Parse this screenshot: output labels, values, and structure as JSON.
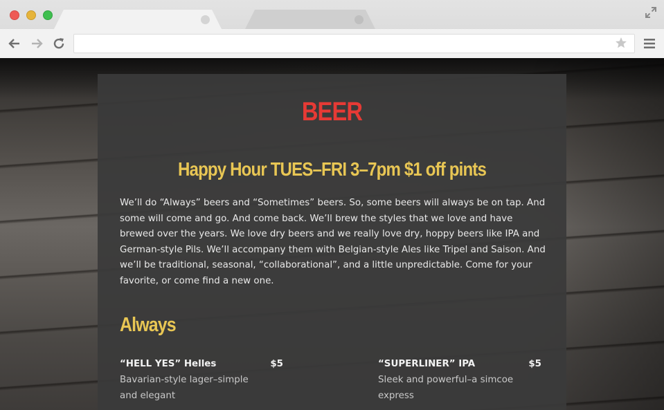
{
  "browser": {
    "tabs": [
      {
        "label": "",
        "active": true
      },
      {
        "label": "",
        "active": false
      }
    ],
    "address_bar": {
      "value": "",
      "placeholder": ""
    }
  },
  "page": {
    "title": "BEER",
    "happy_hour": "Happy Hour TUES–FRI 3–7pm $1 off pints",
    "intro": "We’ll do “Always” beers and “Sometimes” beers. So, some beers will always be on tap. And some will come and go. And come back. We’ll brew the styles that we love and have brewed over the years. We love dry beers and we really love dry, hoppy beers like IPA and German-style Pils. We’ll accompany them with Belgian-style Ales like Tripel and Saison. And we’ll be traditional, seasonal, “collaborational”, and a little unpredictable. Come for your favorite, or come find a new one.",
    "always_heading": "Always",
    "beers": [
      {
        "name": "“HELL YES” Helles",
        "price": "$5",
        "description": "Bavarian-style lager–simple and elegant"
      },
      {
        "name": "“SUPERLINER” IPA",
        "price": "$5",
        "description": "Sleek and powerful–a simcoe express"
      }
    ]
  },
  "colors": {
    "title_red": "#e63a35",
    "heading_yellow": "#e8c654",
    "panel_bg": "#3a3a3a",
    "body_text": "#e9e9e9"
  },
  "icons": [
    "back-arrow-icon",
    "forward-arrow-icon",
    "reload-icon",
    "bookmark-star-icon",
    "hamburger-menu-icon",
    "fullscreen-icon"
  ]
}
